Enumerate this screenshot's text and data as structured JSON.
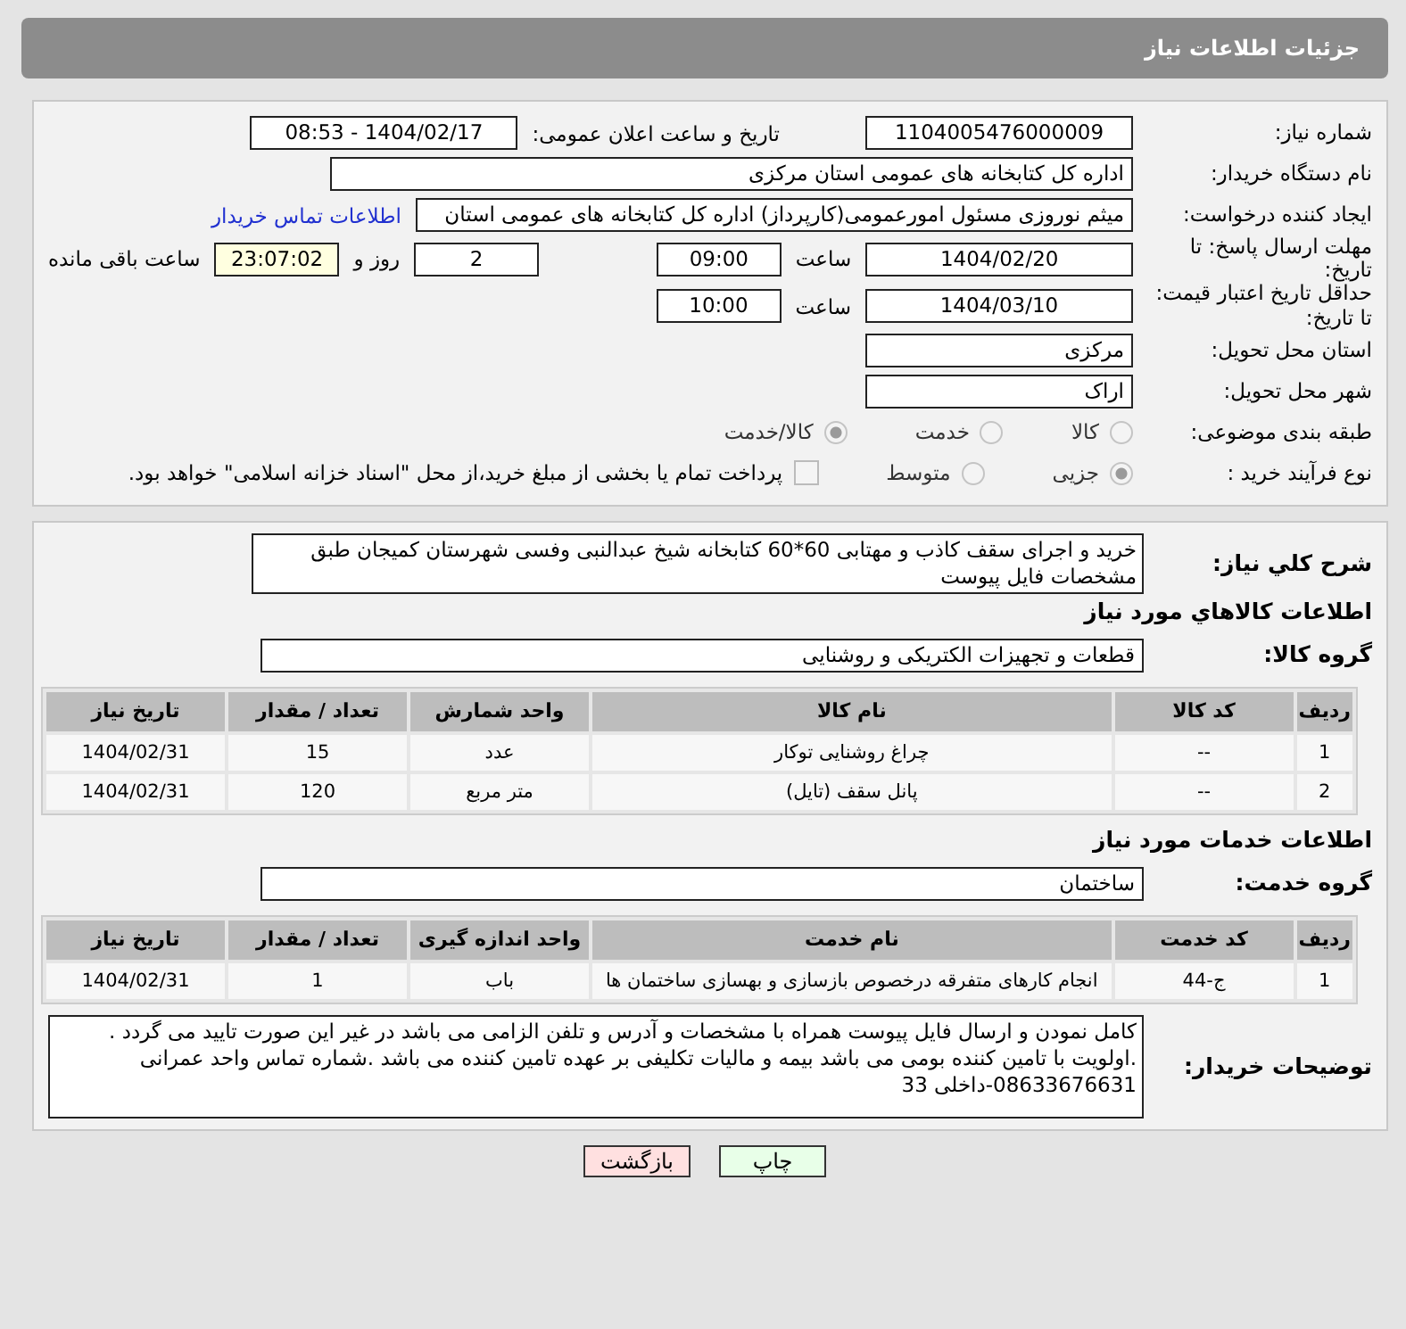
{
  "header": {
    "title": "جزئیات اطلاعات نیاز"
  },
  "need_number": {
    "label": "شماره نیاز:",
    "value": "1104005476000009"
  },
  "announce": {
    "label": "تاریخ و ساعت اعلان عمومی:",
    "value": "1404/02/17 - 08:53"
  },
  "buyer": {
    "label": "نام دستگاه خریدار:",
    "value": "اداره کل کتابخانه های عمومی استان مرکزی"
  },
  "requester": {
    "label": "ایجاد کننده درخواست:",
    "value": "میثم نوروزی مسئول امورعمومی(کارپرداز) اداره کل کتابخانه های عمومی استان",
    "link": "اطلاعات تماس خریدار"
  },
  "deadline": {
    "label": "مهلت ارسال پاسخ: تا تاریخ:",
    "date": "1404/02/20",
    "time_label": "ساعت",
    "time": "09:00",
    "days": "2",
    "days_label": "روز و",
    "remaining": "23:07:02",
    "remaining_label": "ساعت باقی مانده"
  },
  "validity": {
    "label": "حداقل تاریخ اعتبار قیمت: تا تاریخ:",
    "date": "1404/03/10",
    "time_label": "ساعت",
    "time": "10:00"
  },
  "province": {
    "label": "استان محل تحویل:",
    "value": "مرکزی"
  },
  "city": {
    "label": "شهر محل تحویل:",
    "value": "اراک"
  },
  "category": {
    "label": "طبقه بندی موضوعی:",
    "options": [
      {
        "label": "کالا",
        "selected": false
      },
      {
        "label": "خدمت",
        "selected": false
      },
      {
        "label": "کالا/خدمت",
        "selected": true
      }
    ]
  },
  "process": {
    "label": "نوع فرآیند خرید :",
    "options": [
      {
        "label": "جزیی",
        "selected": true
      },
      {
        "label": "متوسط",
        "selected": false
      }
    ],
    "payment": {
      "label": "پرداخت تمام یا بخشی از مبلغ خرید،از محل \"اسناد خزانه اسلامی\" خواهد بود.",
      "checked": false
    }
  },
  "description": {
    "label": "شرح کلي نياز:",
    "value": "خرید و اجرای سقف کاذب  و مهتابی 60*60 کتابخانه شیخ عبدالنبی وفسی شهرستان کمیجان طبق مشخصات فایل پیوست"
  },
  "goods": {
    "title": "اطلاعات کالاهاي مورد نياز",
    "group_label": "گروه کالا:",
    "group": "قطعات و تجهیزات الکتریکی و روشنایی",
    "columns": [
      "ردیف",
      "کد کالا",
      "نام کالا",
      "واحد شمارش",
      "تعداد / مقدار",
      "تاریخ نیاز"
    ],
    "rows": [
      [
        "1",
        "--",
        "چراغ روشنایی توکار",
        "عدد",
        "15",
        "1404/02/31"
      ],
      [
        "2",
        "--",
        "پانل سقف (تایل)",
        "متر مربع",
        "120",
        "1404/02/31"
      ]
    ]
  },
  "services": {
    "title": "اطلاعات خدمات مورد نیاز",
    "group_label": "گروه خدمت:",
    "group": "ساختمان",
    "columns": [
      "ردیف",
      "کد خدمت",
      "نام خدمت",
      "واحد اندازه گیری",
      "تعداد / مقدار",
      "تاریخ نیاز"
    ],
    "rows": [
      [
        "1",
        "ج-44",
        "انجام کارهای متفرقه درخصوص بازسازی و بهسازی ساختمان ها",
        "باب",
        "1",
        "1404/02/31"
      ]
    ]
  },
  "notes": {
    "label": "توضیحات خریدار:",
    "value": "کامل نمودن و ارسال فایل پیوست همراه با مشخصات و آدرس و تلفن الزامی می باشد در غیر این صورت تایید می گردد . .اولویت با تامین کننده بومی می باشد بیمه و مالیات تکلیفی بر عهده تامین کننده می باشد .شماره تماس واحد عمرانی 08633676631-داخلی 33"
  },
  "buttons": [
    {
      "label": "چاپ",
      "kind": "print"
    },
    {
      "label": "بازگشت",
      "kind": "back"
    }
  ]
}
